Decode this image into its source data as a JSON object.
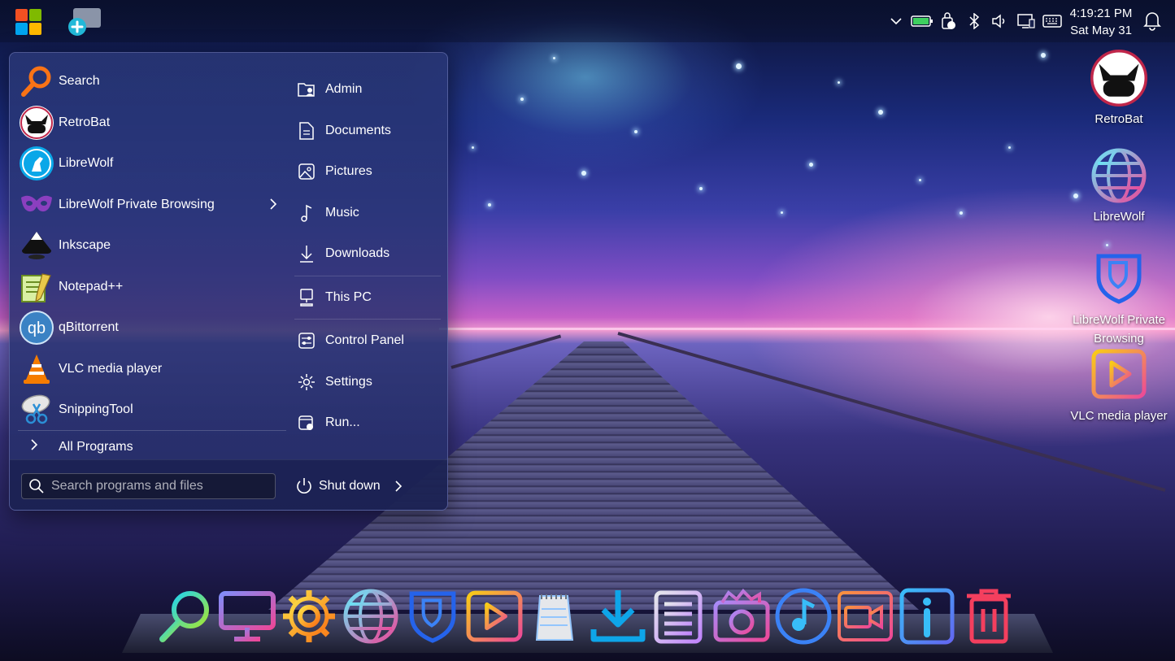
{
  "taskbar": {
    "time": "4:19:21 PM",
    "date": "Sat May 31",
    "tray_icons": [
      "chevron-up-icon",
      "battery-icon",
      "security-icon",
      "bluetooth-icon",
      "volume-icon",
      "display-icon",
      "keyboard-icon"
    ]
  },
  "start_menu": {
    "apps": [
      {
        "label": "Search",
        "icon": "search-icon"
      },
      {
        "label": "RetroBat",
        "icon": "retrobat-icon"
      },
      {
        "label": "LibreWolf",
        "icon": "librewolf-icon"
      },
      {
        "label": "LibreWolf Private Browsing",
        "icon": "mask-icon",
        "has_submenu": true
      },
      {
        "label": "Inkscape",
        "icon": "inkscape-icon"
      },
      {
        "label": "Notepad++",
        "icon": "notepadpp-icon"
      },
      {
        "label": "qBittorrent",
        "icon": "qbittorrent-icon"
      },
      {
        "label": "VLC media player",
        "icon": "vlc-icon"
      },
      {
        "label": "SnippingTool",
        "icon": "snipping-tool-icon"
      }
    ],
    "all_programs": "All Programs",
    "places": [
      {
        "label": "Admin",
        "icon": "user-folder-icon"
      },
      {
        "label": "Documents",
        "icon": "document-icon"
      },
      {
        "label": "Pictures",
        "icon": "picture-icon"
      },
      {
        "label": "Music",
        "icon": "music-note-icon"
      },
      {
        "label": "Downloads",
        "icon": "download-icon"
      },
      {
        "label": "This PC",
        "icon": "computer-icon"
      },
      {
        "label": "Control Panel",
        "icon": "control-panel-icon"
      },
      {
        "label": "Settings",
        "icon": "gear-icon"
      },
      {
        "label": "Run...",
        "icon": "run-icon"
      }
    ],
    "search_placeholder": "Search programs and files",
    "shutdown_label": "Shut down"
  },
  "desktop_icons": [
    {
      "label": "RetroBat",
      "icon": "retrobat-icon"
    },
    {
      "label": "LibreWolf",
      "icon": "librewolf-globe-icon"
    },
    {
      "label": "LibreWolf Private Browsing",
      "icon": "shield-icon"
    },
    {
      "label": "VLC media player",
      "icon": "play-icon"
    }
  ],
  "dock": [
    "search-icon",
    "monitor-icon",
    "gear-icon",
    "globe-icon",
    "shield-icon",
    "play-icon",
    "notepad-icon",
    "download-icon",
    "list-icon",
    "camera-icon",
    "music-icon",
    "video-camera-icon",
    "info-icon",
    "trash-icon"
  ],
  "colors": {
    "menu_bg": "#2a3878",
    "accent_cyan": "#22d3ee",
    "accent_pink": "#ec4899",
    "accent_orange": "#f97316"
  }
}
